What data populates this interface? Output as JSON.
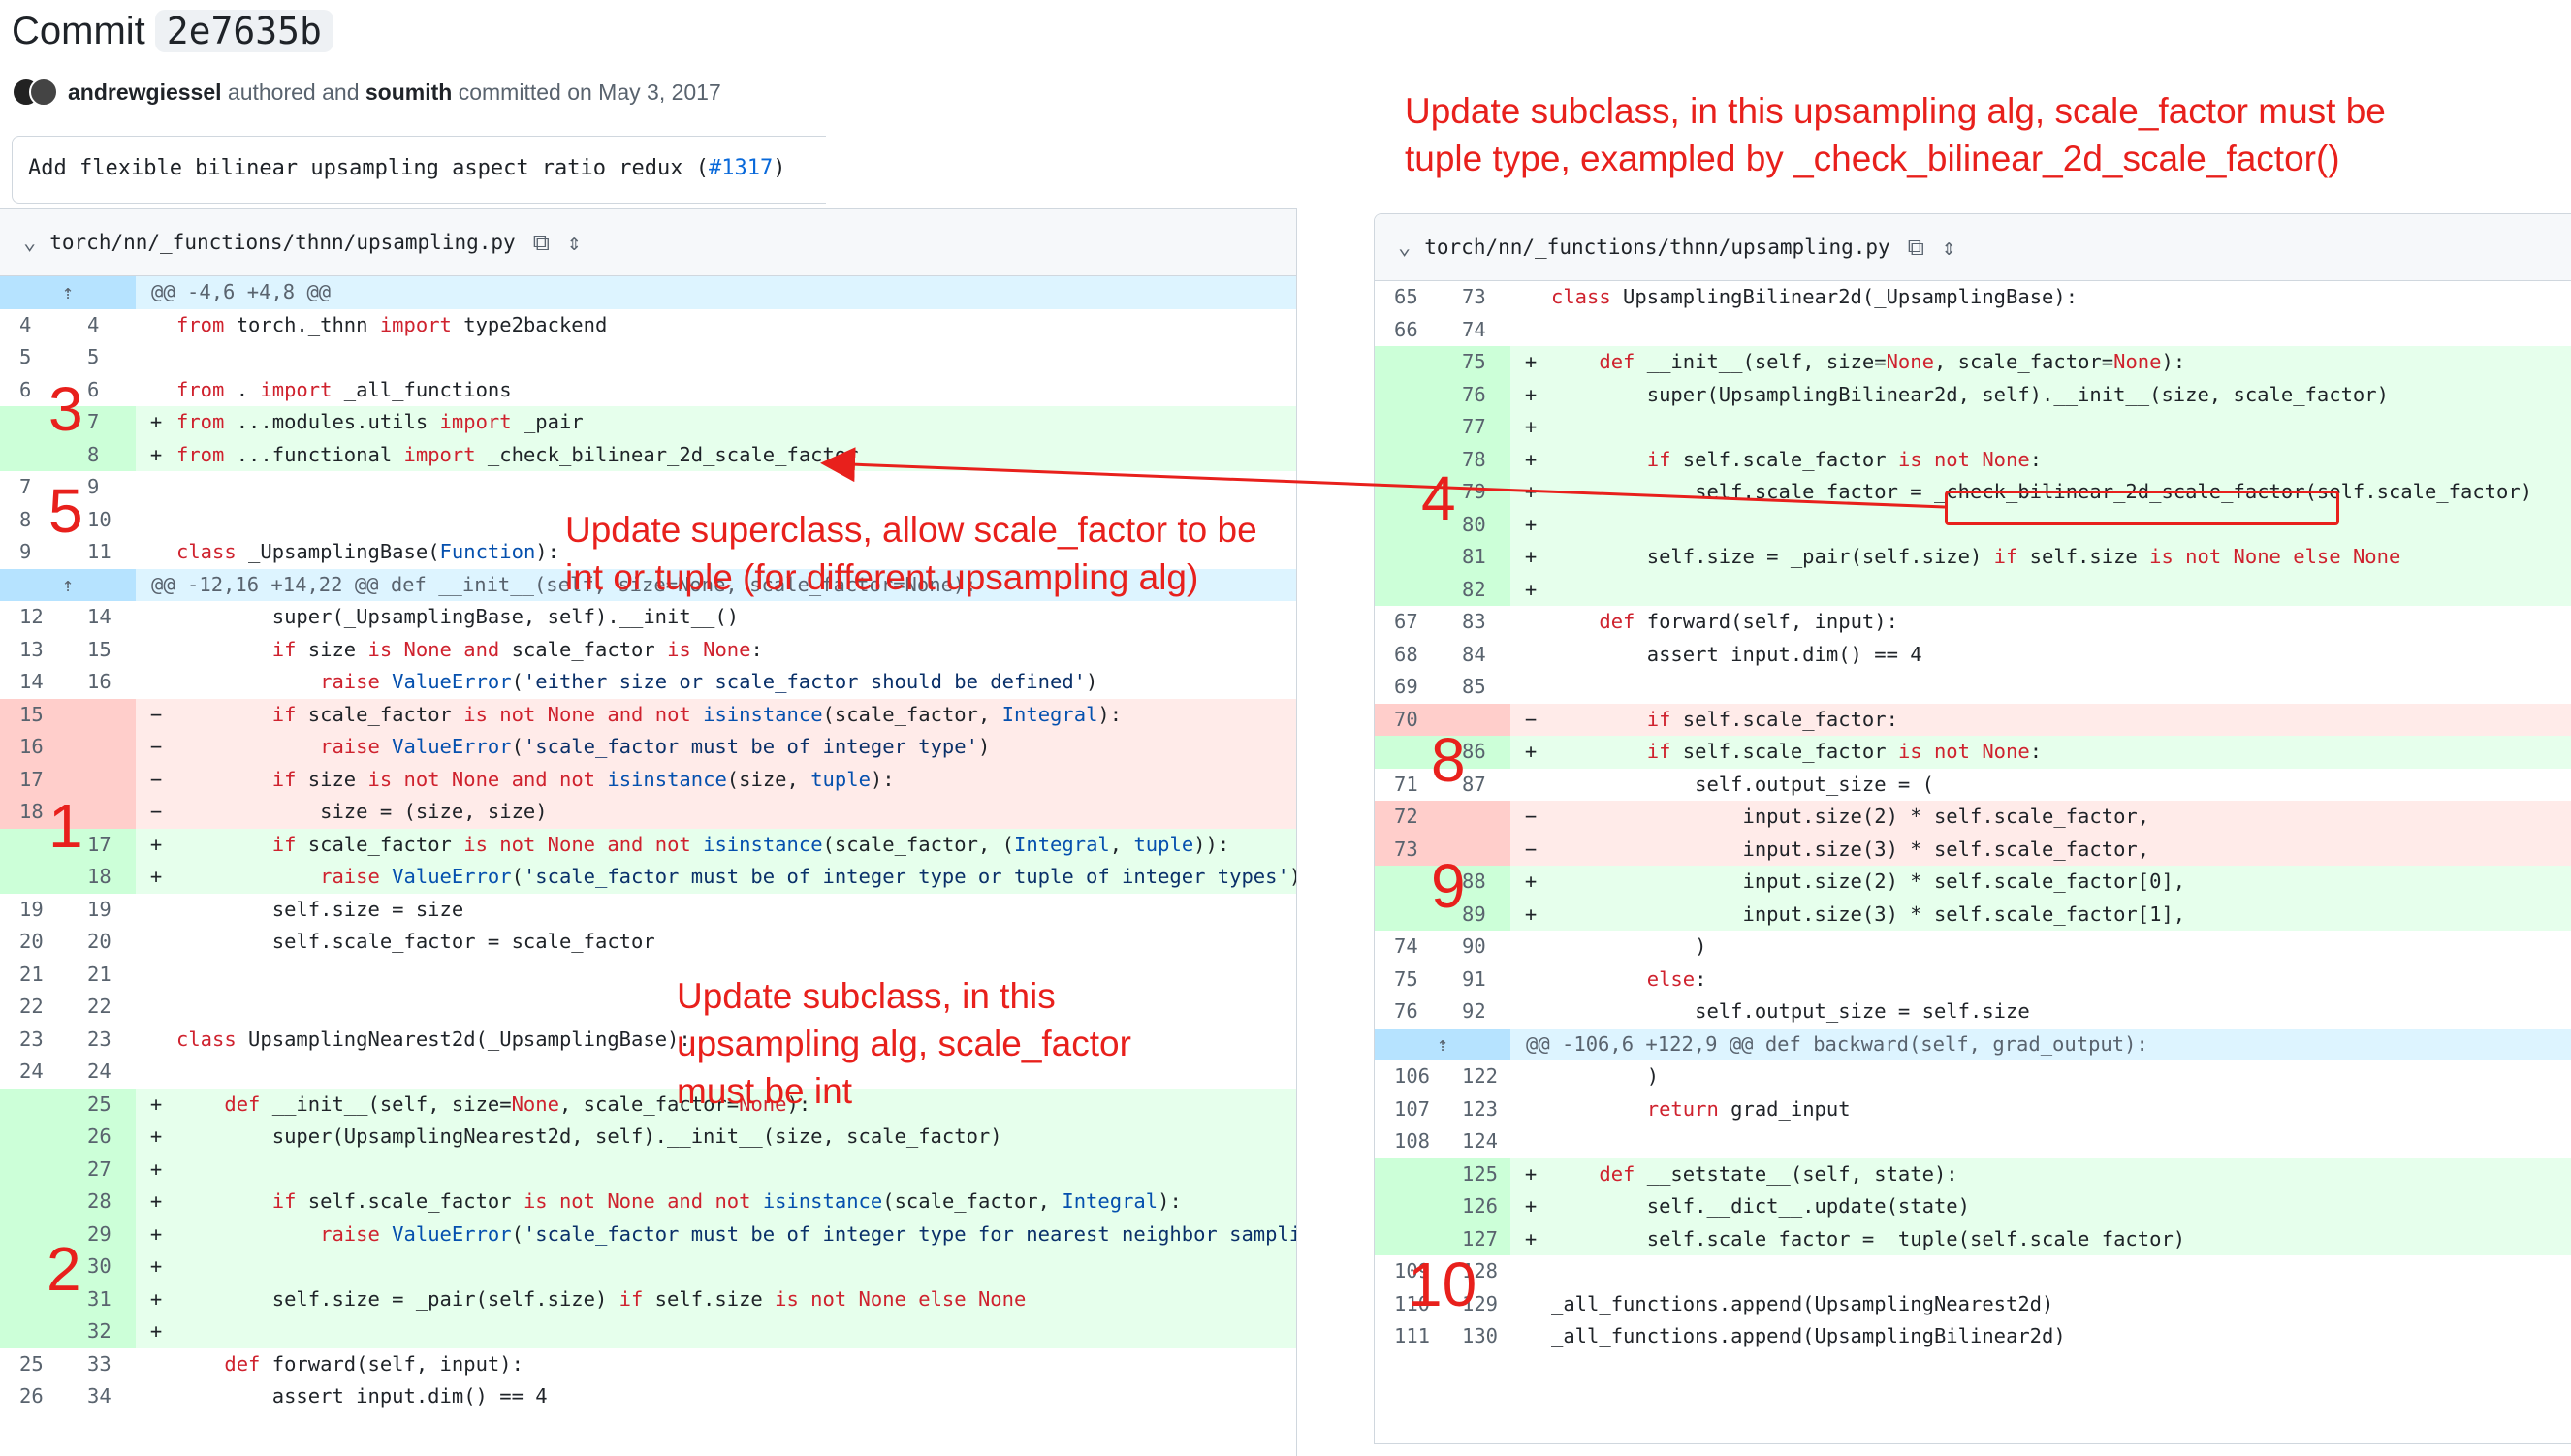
{
  "commit": {
    "label": "Commit",
    "hash": "2e7635b",
    "author": "andrewgiessel",
    "authored_text": "authored and",
    "committer": "soumith",
    "committed_text": "committed on May 3, 2017",
    "message": "Add flexible bilinear upsampling aspect ratio redux (",
    "pr": "#1317",
    "message_end": ")"
  },
  "left_file": {
    "path": "torch/nn/_functions/thnn/upsampling.py"
  },
  "right_file": {
    "path": "torch/nn/_functions/thnn/upsampling.py"
  },
  "icons": [
    "chevron-down-icon",
    "copy-icon",
    "expand-icon",
    "expand-up-icon",
    "expand-down-icon"
  ],
  "left_rows": [
    {
      "type": "hunk",
      "old": "",
      "new": "",
      "code": "@@ -4,6 +4,8 @@"
    },
    {
      "type": "ctx",
      "old": "4",
      "new": "4",
      "code": "from torch._thnn import type2backend"
    },
    {
      "type": "ctx",
      "old": "5",
      "new": "5",
      "code": ""
    },
    {
      "type": "ctx",
      "old": "6",
      "new": "6",
      "code": "from . import _all_functions"
    },
    {
      "type": "add",
      "old": "",
      "new": "7",
      "code": "from ...modules.utils import _pair"
    },
    {
      "type": "add",
      "old": "",
      "new": "8",
      "code": "from ...functional import _check_bilinear_2d_scale_factor"
    },
    {
      "type": "ctx",
      "old": "7",
      "new": "9",
      "code": ""
    },
    {
      "type": "ctx",
      "old": "8",
      "new": "10",
      "code": ""
    },
    {
      "type": "ctx",
      "old": "9",
      "new": "11",
      "code": "class _UpsamplingBase(Function):"
    },
    {
      "type": "hunk",
      "old": "",
      "new": "",
      "code": "@@ -12,16 +14,22 @@ def __init__(self, size=None, scale_factor=None):"
    },
    {
      "type": "ctx",
      "old": "12",
      "new": "14",
      "code": "        super(_UpsamplingBase, self).__init__()"
    },
    {
      "type": "ctx",
      "old": "13",
      "new": "15",
      "code": "        if size is None and scale_factor is None:"
    },
    {
      "type": "ctx",
      "old": "14",
      "new": "16",
      "code": "            raise ValueError('either size or scale_factor should be defined')"
    },
    {
      "type": "del",
      "old": "15",
      "new": "",
      "code": "        if scale_factor is not None and not isinstance(scale_factor, Integral):"
    },
    {
      "type": "del",
      "old": "16",
      "new": "",
      "code": "            raise ValueError('scale_factor must be of integer type')"
    },
    {
      "type": "del",
      "old": "17",
      "new": "",
      "code": "        if size is not None and not isinstance(size, tuple):"
    },
    {
      "type": "del",
      "old": "18",
      "new": "",
      "code": "            size = (size, size)"
    },
    {
      "type": "add",
      "old": "",
      "new": "17",
      "code": "        if scale_factor is not None and not isinstance(scale_factor, (Integral, tuple)):"
    },
    {
      "type": "add",
      "old": "",
      "new": "18",
      "code": "            raise ValueError('scale_factor must be of integer type or tuple of integer types')"
    },
    {
      "type": "ctx",
      "old": "19",
      "new": "19",
      "code": "        self.size = size"
    },
    {
      "type": "ctx",
      "old": "20",
      "new": "20",
      "code": "        self.scale_factor = scale_factor"
    },
    {
      "type": "ctx",
      "old": "21",
      "new": "21",
      "code": ""
    },
    {
      "type": "ctx",
      "old": "22",
      "new": "22",
      "code": ""
    },
    {
      "type": "ctx",
      "old": "23",
      "new": "23",
      "code": "class UpsamplingNearest2d(_UpsamplingBase):"
    },
    {
      "type": "ctx",
      "old": "24",
      "new": "24",
      "code": ""
    },
    {
      "type": "add",
      "old": "",
      "new": "25",
      "code": "    def __init__(self, size=None, scale_factor=None):"
    },
    {
      "type": "add",
      "old": "",
      "new": "26",
      "code": "        super(UpsamplingNearest2d, self).__init__(size, scale_factor)"
    },
    {
      "type": "add",
      "old": "",
      "new": "27",
      "code": ""
    },
    {
      "type": "add",
      "old": "",
      "new": "28",
      "code": "        if self.scale_factor is not None and not isinstance(scale_factor, Integral):"
    },
    {
      "type": "add",
      "old": "",
      "new": "29",
      "code": "            raise ValueError('scale_factor must be of integer type for nearest neighbor sampling')"
    },
    {
      "type": "add",
      "old": "",
      "new": "30",
      "code": ""
    },
    {
      "type": "add",
      "old": "",
      "new": "31",
      "code": "        self.size = _pair(self.size) if self.size is not None else None"
    },
    {
      "type": "add",
      "old": "",
      "new": "32",
      "code": ""
    },
    {
      "type": "ctx",
      "old": "25",
      "new": "33",
      "code": "    def forward(self, input):"
    },
    {
      "type": "ctx",
      "old": "26",
      "new": "34",
      "code": "        assert input.dim() == 4"
    }
  ],
  "right_rows": [
    {
      "type": "ctx",
      "old": "65",
      "new": "73",
      "code": "class UpsamplingBilinear2d(_UpsamplingBase):"
    },
    {
      "type": "ctx",
      "old": "66",
      "new": "74",
      "code": ""
    },
    {
      "type": "add",
      "old": "",
      "new": "75",
      "code": "    def __init__(self, size=None, scale_factor=None):"
    },
    {
      "type": "add",
      "old": "",
      "new": "76",
      "code": "        super(UpsamplingBilinear2d, self).__init__(size, scale_factor)"
    },
    {
      "type": "add",
      "old": "",
      "new": "77",
      "code": ""
    },
    {
      "type": "add",
      "old": "",
      "new": "78",
      "code": "        if self.scale_factor is not None:"
    },
    {
      "type": "add",
      "old": "",
      "new": "79",
      "code": "            self.scale_factor = _check_bilinear_2d_scale_factor(self.scale_factor)"
    },
    {
      "type": "add",
      "old": "",
      "new": "80",
      "code": ""
    },
    {
      "type": "add",
      "old": "",
      "new": "81",
      "code": "        self.size = _pair(self.size) if self.size is not None else None"
    },
    {
      "type": "add",
      "old": "",
      "new": "82",
      "code": ""
    },
    {
      "type": "ctx",
      "old": "67",
      "new": "83",
      "code": "    def forward(self, input):"
    },
    {
      "type": "ctx",
      "old": "68",
      "new": "84",
      "code": "        assert input.dim() == 4"
    },
    {
      "type": "ctx",
      "old": "69",
      "new": "85",
      "code": ""
    },
    {
      "type": "del",
      "old": "70",
      "new": "",
      "code": "        if self.scale_factor:"
    },
    {
      "type": "add",
      "old": "",
      "new": "86",
      "code": "        if self.scale_factor is not None:"
    },
    {
      "type": "ctx",
      "old": "71",
      "new": "87",
      "code": "            self.output_size = ("
    },
    {
      "type": "del",
      "old": "72",
      "new": "",
      "code": "                input.size(2) * self.scale_factor,"
    },
    {
      "type": "del",
      "old": "73",
      "new": "",
      "code": "                input.size(3) * self.scale_factor,"
    },
    {
      "type": "add",
      "old": "",
      "new": "88",
      "code": "                input.size(2) * self.scale_factor[0],"
    },
    {
      "type": "add",
      "old": "",
      "new": "89",
      "code": "                input.size(3) * self.scale_factor[1],"
    },
    {
      "type": "ctx",
      "old": "74",
      "new": "90",
      "code": "            )"
    },
    {
      "type": "ctx",
      "old": "75",
      "new": "91",
      "code": "        else:"
    },
    {
      "type": "ctx",
      "old": "76",
      "new": "92",
      "code": "            self.output_size = self.size"
    },
    {
      "type": "hunk",
      "old": "",
      "new": "",
      "code": "@@ -106,6 +122,9 @@ def backward(self, grad_output):"
    },
    {
      "type": "ctx",
      "old": "106",
      "new": "122",
      "code": "        )"
    },
    {
      "type": "ctx",
      "old": "107",
      "new": "123",
      "code": "        return grad_input"
    },
    {
      "type": "ctx",
      "old": "108",
      "new": "124",
      "code": ""
    },
    {
      "type": "add",
      "old": "",
      "new": "125",
      "code": "    def __setstate__(self, state):"
    },
    {
      "type": "add",
      "old": "",
      "new": "126",
      "code": "        self.__dict__.update(state)"
    },
    {
      "type": "add",
      "old": "",
      "new": "127",
      "code": "        self.scale_factor = _tuple(self.scale_factor)"
    },
    {
      "type": "ctx",
      "old": "109",
      "new": "128",
      "code": ""
    },
    {
      "type": "ctx",
      "old": "110",
      "new": "129",
      "code": "_all_functions.append(UpsamplingNearest2d)"
    },
    {
      "type": "ctx",
      "old": "111",
      "new": "130",
      "code": "_all_functions.append(UpsamplingBilinear2d)"
    }
  ],
  "annotations": {
    "top_right_1": "Update subclass, in this upsampling alg, scale_factor must be",
    "top_right_2": "tuple type, exampled by _check_bilinear_2d_scale_factor()",
    "superclass_1": "Update superclass, allow scale_factor to be",
    "superclass_2": "int or tuple (for different upsampling alg)",
    "subclass_1": "Update subclass, in this",
    "subclass_2": "upsampling alg, scale_factor",
    "subclass_3": "must be int"
  },
  "step_numbers": {
    "n1": "1",
    "n2": "2",
    "n3": "3",
    "n4": "4",
    "n5": "5",
    "n8": "8",
    "n9": "9",
    "n10": "10"
  },
  "colors": {
    "annotation": "#e8201c",
    "add_bg": "#e6ffec",
    "del_bg": "#ffebe9",
    "hunk_bg": "#ddf4ff"
  }
}
